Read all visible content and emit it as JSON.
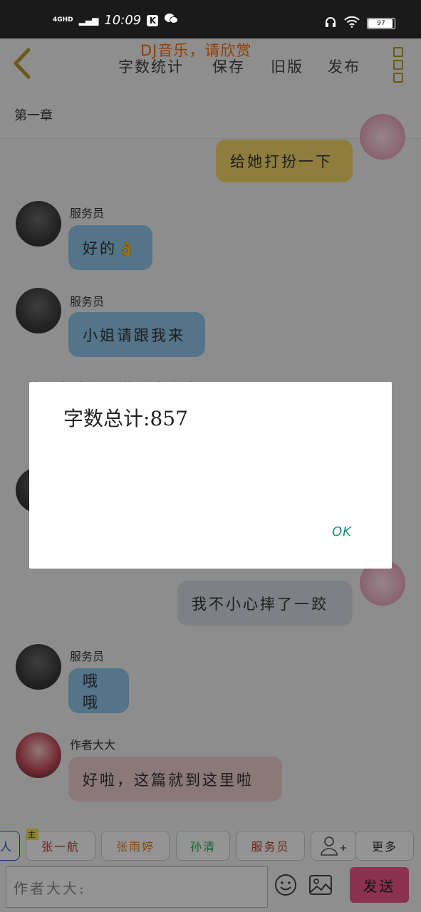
{
  "status_bar": {
    "network": "4GHD",
    "time": "10:09",
    "k_badge": "K",
    "battery": "97"
  },
  "toolbar": {
    "word_count": "字数统计",
    "save": "保存",
    "old_version": "旧版",
    "publish": "发布",
    "music_banner": "DJ音乐，请欣赏"
  },
  "chapter": {
    "title": "第一章"
  },
  "messages": [
    {
      "side": "right",
      "sender": "",
      "text": "给她打扮一下",
      "color": "yellow"
    },
    {
      "side": "left",
      "sender": "服务员",
      "text": "好的👌",
      "color": "blue"
    },
    {
      "side": "left",
      "sender": "服务员",
      "text": "小姐请跟我来",
      "color": "blue"
    },
    {
      "side": "right",
      "sender": "",
      "text": "我不小心摔了一跤",
      "color": "grey"
    },
    {
      "side": "left",
      "sender": "服务员",
      "text": "哦哦",
      "color": "blue"
    },
    {
      "side": "left",
      "sender": "作者大大",
      "text": "好啦，这篇就到这里啦",
      "color": "pink"
    }
  ],
  "hidden_line": "旅一行在门口的沙发上坐下了",
  "dialog": {
    "label": "字数总计",
    "value": ":857",
    "ok": "OK"
  },
  "roles": [
    {
      "label": "人",
      "color": "#2b5fb8"
    },
    {
      "label": "张一航",
      "color": "#c0392b",
      "badge": "主"
    },
    {
      "label": "张雨婷",
      "color": "#e67e22"
    },
    {
      "label": "孙清",
      "color": "#27ae60"
    },
    {
      "label": "服务员",
      "color": "#c0392b"
    }
  ],
  "more_label": "更多",
  "input": {
    "placeholder": "作者大大:"
  },
  "send_label": "发送"
}
